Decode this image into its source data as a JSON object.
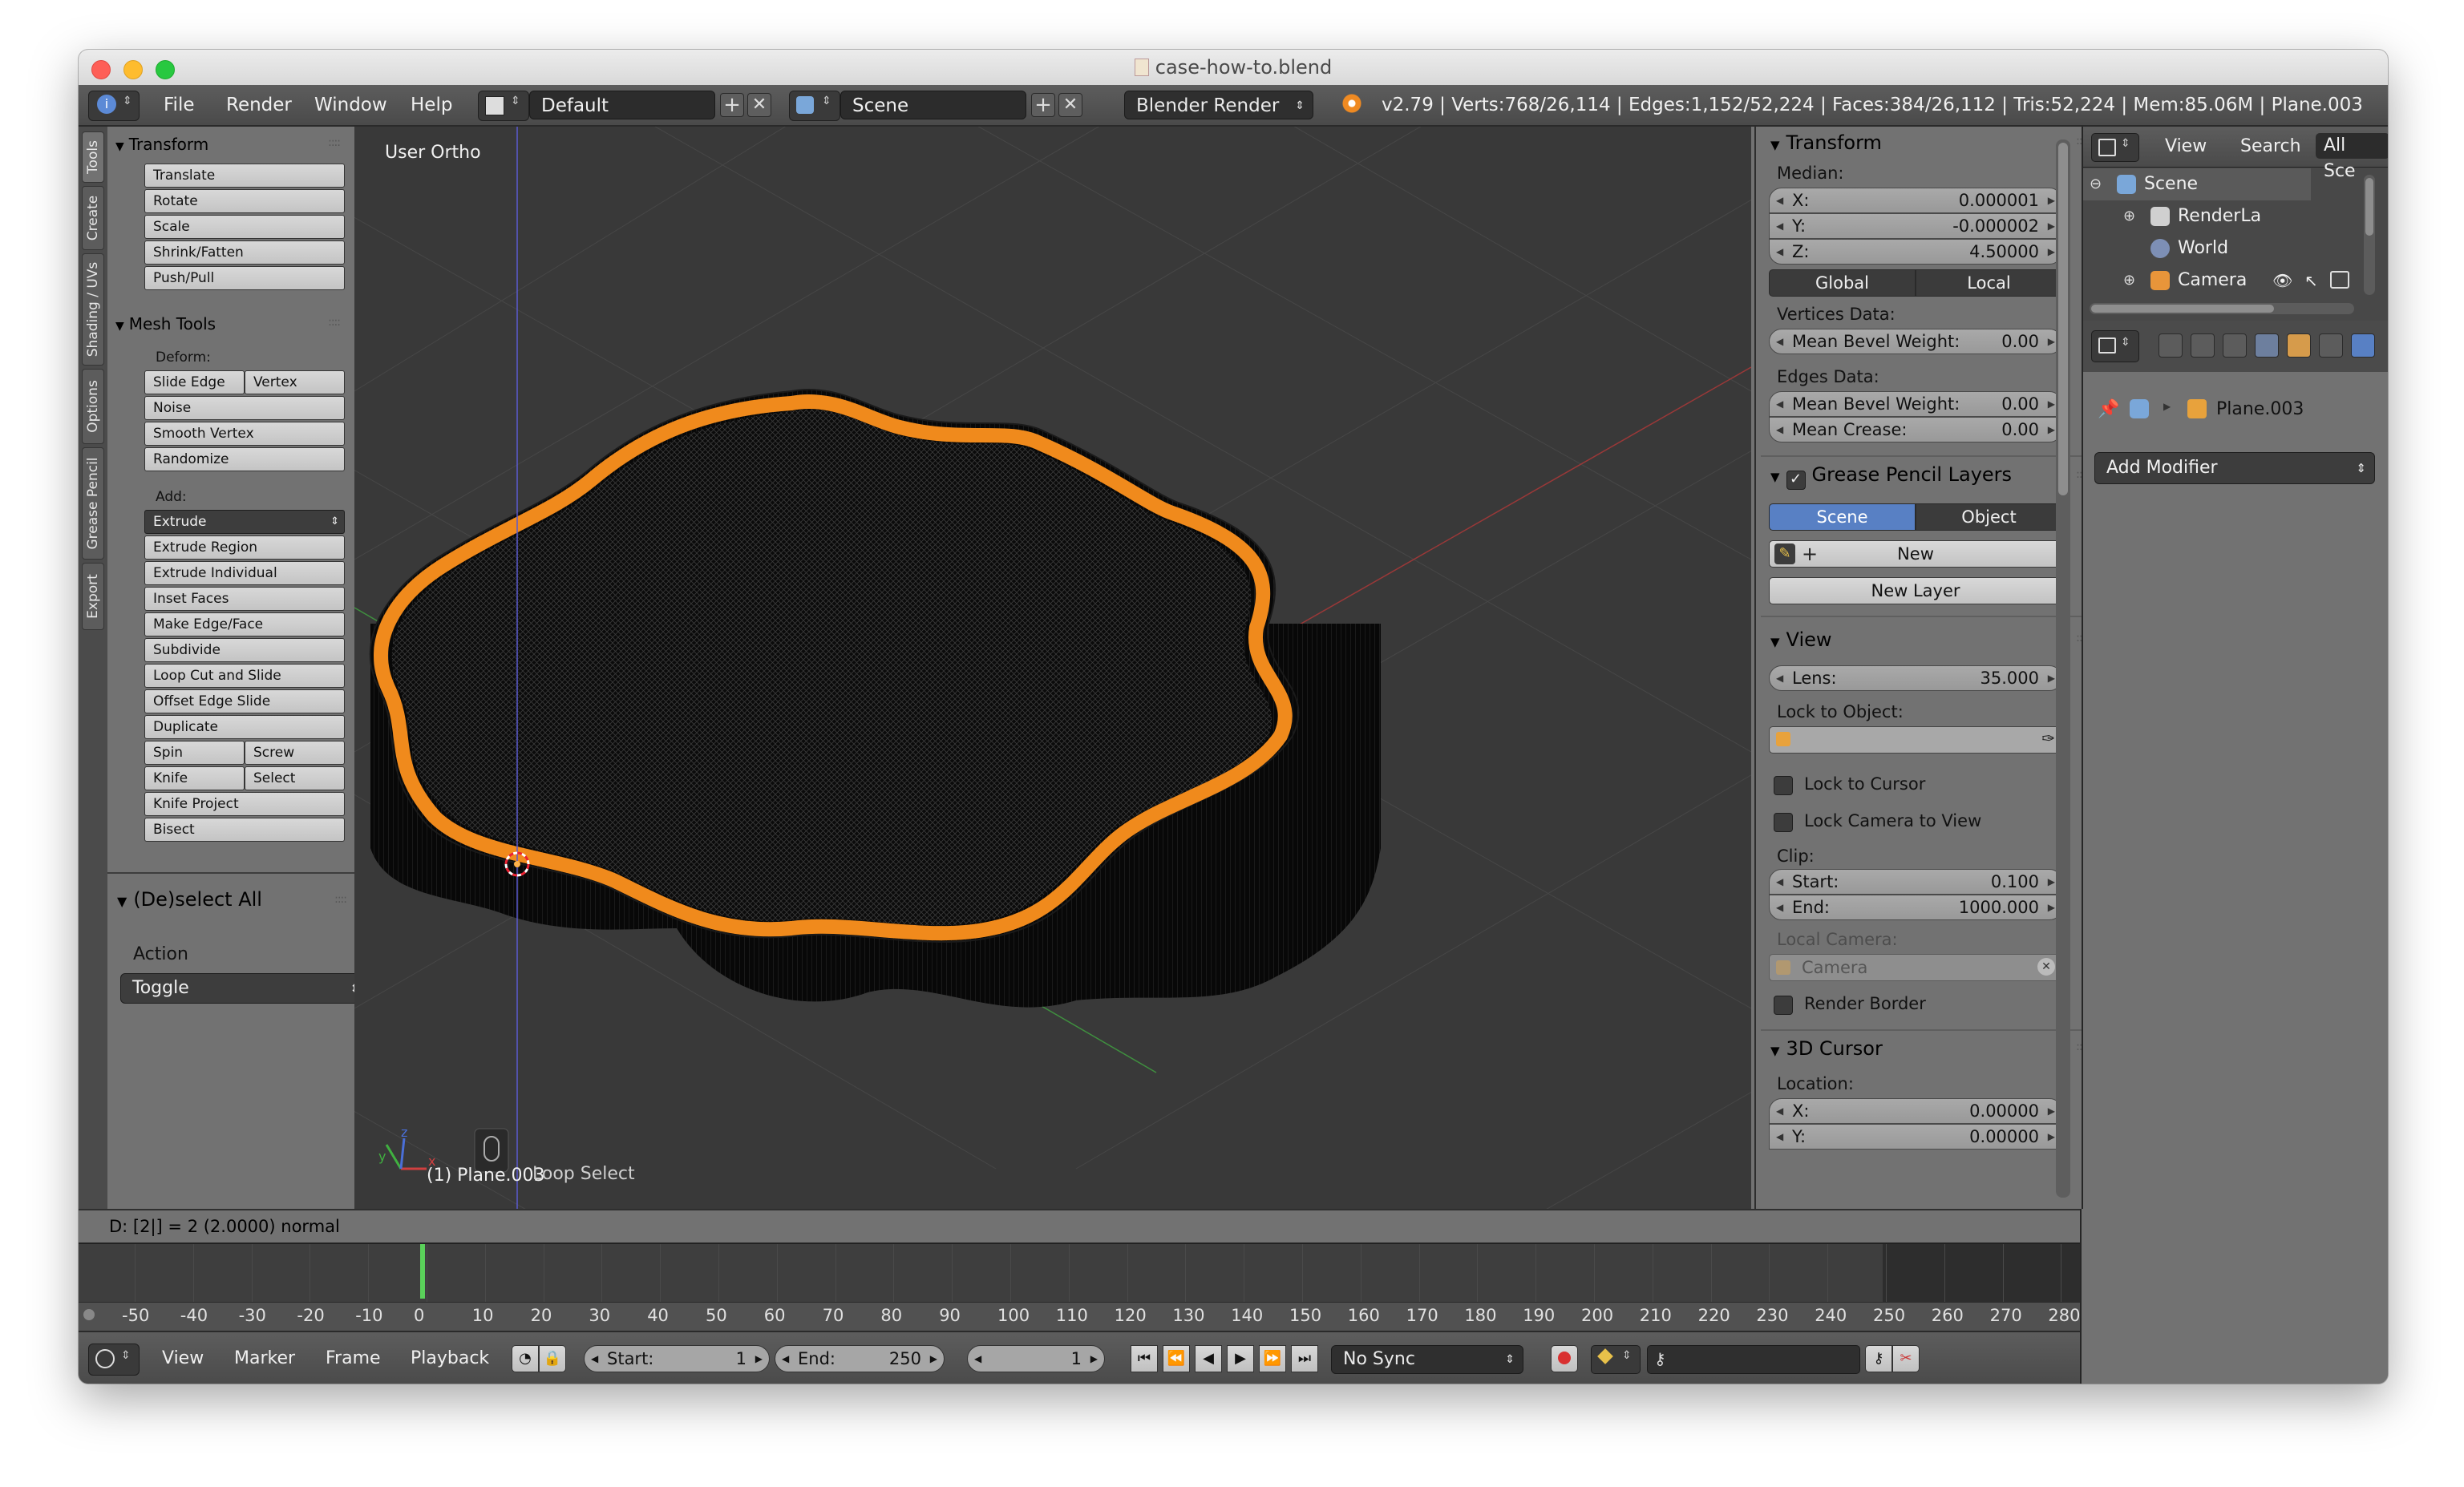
{
  "window": {
    "title": "case-how-to.blend"
  },
  "topbar": {
    "menus": [
      "File",
      "Render",
      "Window",
      "Help"
    ],
    "layout": "Default",
    "scene": "Scene",
    "engine": "Blender Render",
    "stats": "v2.79 | Verts:768/26,114 | Edges:1,152/52,224 | Faces:384/26,112 | Tris:52,224 | Mem:85.06M | Plane.003"
  },
  "vtabs": [
    "Tools",
    "Create",
    "Shading / UVs",
    "Options",
    "Grease Pencil",
    "Export"
  ],
  "toolshelf": {
    "transform": {
      "title": "Transform",
      "buttons": [
        "Translate",
        "Rotate",
        "Scale",
        "Shrink/Fatten",
        "Push/Pull"
      ]
    },
    "mesh_tools": {
      "title": "Mesh Tools",
      "deform_label": "Deform:",
      "slide_edge": "Slide Edge",
      "vertex": "Vertex",
      "noise": "Noise",
      "smooth_vertex": "Smooth Vertex",
      "randomize": "Randomize",
      "add_label": "Add:",
      "extrude": "Extrude",
      "add_buttons": [
        "Extrude Region",
        "Extrude Individual",
        "Inset Faces",
        "Make Edge/Face",
        "Subdivide",
        "Loop Cut and Slide",
        "Offset Edge Slide",
        "Duplicate"
      ],
      "spin": "Spin",
      "screw": "Screw",
      "knife": "Knife",
      "select": "Select",
      "knife_project": "Knife Project",
      "bisect": "Bisect"
    }
  },
  "operator": {
    "title": "(De)select All",
    "label": "Action",
    "value": "Toggle"
  },
  "viewport": {
    "view_name": "User Ortho",
    "object_label": "(1) Plane.003",
    "operator_hint": "Loop Select"
  },
  "npanel": {
    "transform": {
      "title": "Transform",
      "median_label": "Median:",
      "x_key": "X:",
      "x": "0.000001",
      "y_key": "Y:",
      "y": "-0.000002",
      "z_key": "Z:",
      "z": "4.50000",
      "global": "Global",
      "local": "Local",
      "vertices_data": "Vertices Data:",
      "mbw_key": "Mean Bevel Weight:",
      "mbw_vert": "0.00",
      "edges_data": "Edges Data:",
      "mbw_edge": "0.00",
      "crease_key": "Mean Crease:",
      "crease": "0.00"
    },
    "grease": {
      "title": "Grease Pencil Layers",
      "scene": "Scene",
      "object": "Object",
      "new": "New",
      "new_layer": "New Layer"
    },
    "view": {
      "title": "View",
      "lens_key": "Lens:",
      "lens": "35.000",
      "lock_object": "Lock to Object:",
      "lock_cursor": "Lock to Cursor",
      "lock_camera": "Lock Camera to View",
      "clip": "Clip:",
      "start_key": "Start:",
      "start": "0.100",
      "end_key": "End:",
      "end": "1000.000",
      "local_camera": "Local Camera:",
      "camera": "Camera",
      "render_border": "Render Border"
    },
    "cursor": {
      "title": "3D Cursor",
      "location": "Location:",
      "x_key": "X:",
      "x": "0.00000",
      "y_key": "Y:",
      "y": "0.00000"
    }
  },
  "outliner": {
    "view": "View",
    "search": "Search",
    "all_scenes": "All Sce",
    "items": [
      "Scene",
      "RenderLa",
      "World",
      "Camera"
    ]
  },
  "properties": {
    "object_name": "Plane.003",
    "add_modifier": "Add Modifier"
  },
  "infoline": "D: [2|] = 2 (2.0000) normal",
  "timeline": {
    "ticks": [
      "-50",
      "-40",
      "-30",
      "-20",
      "-10",
      "0",
      "10",
      "20",
      "30",
      "40",
      "50",
      "60",
      "70",
      "80",
      "90",
      "100",
      "110",
      "120",
      "130",
      "140",
      "150",
      "160",
      "170",
      "180",
      "190",
      "200",
      "210",
      "220",
      "230",
      "240",
      "250",
      "260",
      "270",
      "280"
    ],
    "menus": [
      "View",
      "Marker",
      "Frame",
      "Playback"
    ],
    "start_key": "Start:",
    "start": "1",
    "end_key": "End:",
    "end": "250",
    "current": "1",
    "sync": "No Sync"
  },
  "colors": {
    "selection_orange": "#f08a1c",
    "active_blue": "#5880c4",
    "frame_green": "#5ad15a",
    "viewport_bg": "#393939"
  }
}
